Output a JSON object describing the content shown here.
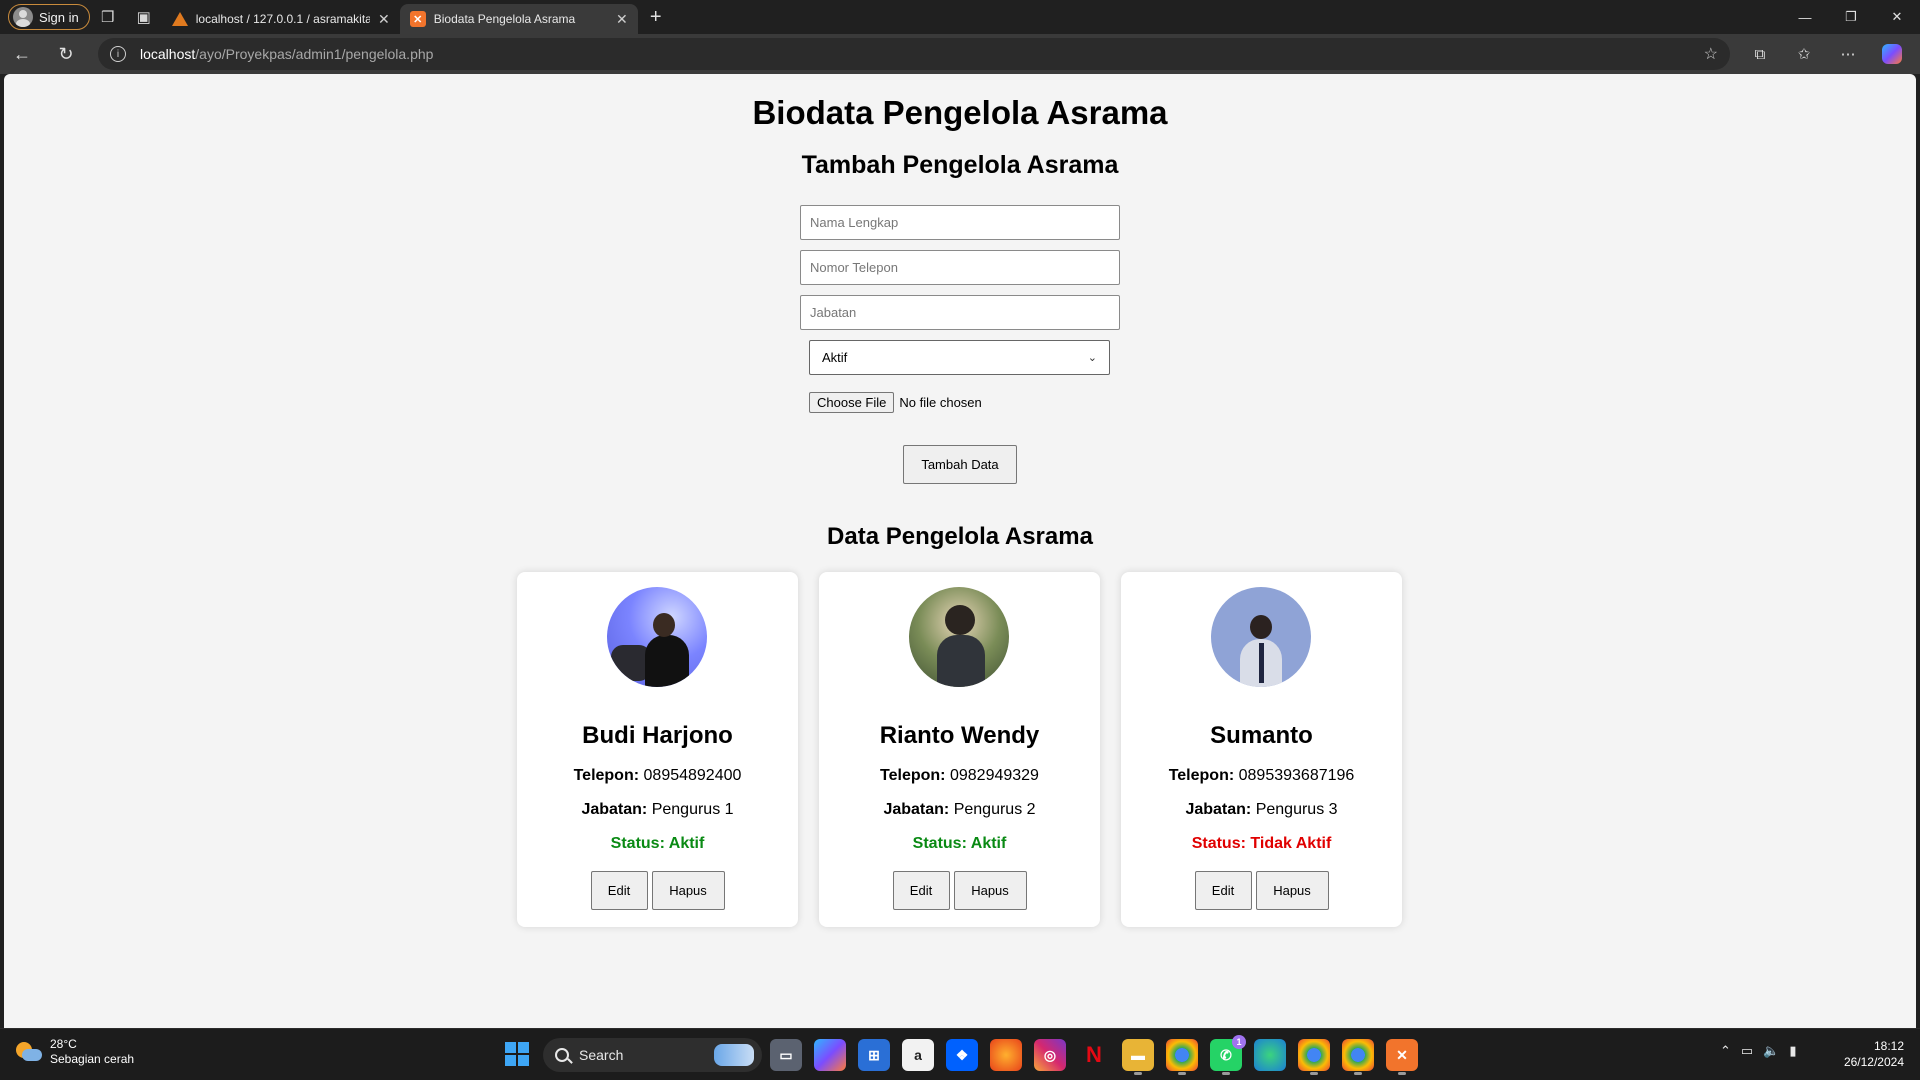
{
  "browser": {
    "profile_label": "Sign in",
    "tabs": [
      {
        "title": "localhost / 127.0.0.1 / asramakita",
        "close": "✕"
      },
      {
        "title": "Biodata Pengelola Asrama",
        "close": "✕"
      }
    ],
    "url_host": "localhost",
    "url_path": "/ayo/Proyekpas/admin1/pengelola.php"
  },
  "page": {
    "title": "Biodata Pengelola Asrama",
    "form_title": "Tambah Pengelola Asrama",
    "form": {
      "name_placeholder": "Nama Lengkap",
      "phone_placeholder": "Nomor Telepon",
      "role_placeholder": "Jabatan",
      "status_selected": "Aktif",
      "file_button": "Choose File",
      "file_status": "No file chosen",
      "submit_label": "Tambah Data"
    },
    "list_title": "Data Pengelola Asrama",
    "labels": {
      "phone": "Telepon:",
      "role": "Jabatan:",
      "status": "Status:",
      "edit": "Edit",
      "delete": "Hapus"
    },
    "managers": [
      {
        "name": "Budi Harjono",
        "phone": "08954892400",
        "role": "Pengurus 1",
        "status": "Aktif"
      },
      {
        "name": "Rianto Wendy",
        "phone": "0982949329",
        "role": "Pengurus 2",
        "status": "Aktif"
      },
      {
        "name": "Sumanto",
        "phone": "0895393687196",
        "role": "Pengurus 3",
        "status": "Tidak Aktif"
      }
    ],
    "colors": {
      "status_active": "#0a8a14",
      "status_inactive": "#e00000"
    }
  },
  "taskbar": {
    "weather_temp": "28°C",
    "weather_desc": "Sebagian cerah",
    "search_label": "Search",
    "whatsapp_badge": "1",
    "clock_time": "18:12",
    "clock_date": "26/12/2024"
  }
}
